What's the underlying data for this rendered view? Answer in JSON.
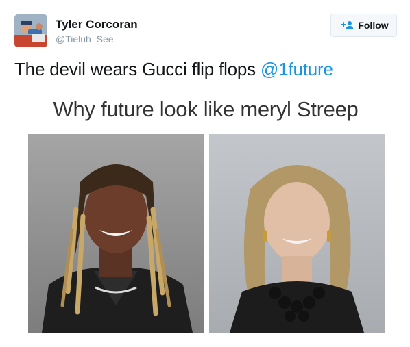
{
  "user": {
    "name": "Tyler Corcoran",
    "handle": "@Tieluh_See"
  },
  "follow_button": {
    "label": "Follow",
    "icon": "follow-person-plus-icon"
  },
  "tweet": {
    "text": "The devil wears Gucci flip flops ",
    "mention": "@1future"
  },
  "media": {
    "caption": "Why future look like meryl Streep"
  },
  "colors": {
    "link": "#1b95e0",
    "handle": "#8899a6",
    "button_bg": "#f5f8fa",
    "button_border": "#e1e8ed"
  }
}
